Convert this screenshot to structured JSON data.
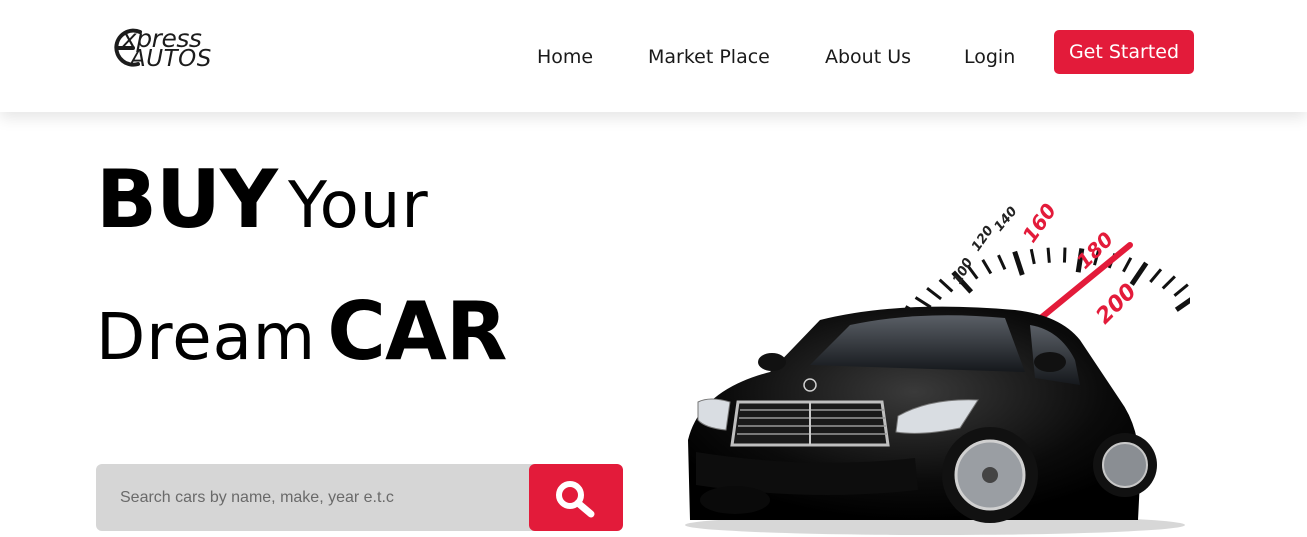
{
  "brand": {
    "logo_top": "xpress",
    "logo_bottom": "AUTOS"
  },
  "nav": {
    "items": [
      {
        "label": "Home"
      },
      {
        "label": "Market Place"
      },
      {
        "label": "About Us"
      },
      {
        "label": "Login"
      }
    ],
    "cta_label": "Get Started"
  },
  "hero": {
    "line1_bold": "BUY",
    "line1_light": "Your",
    "line2_light": "Dream",
    "line2_bold": "CAR"
  },
  "search": {
    "placeholder": "Search cars by name, make, year e.t.c",
    "button_icon": "search-icon"
  },
  "speedometer": {
    "ticks": [
      "100",
      "120",
      "140",
      "160",
      "180",
      "200"
    ]
  },
  "colors": {
    "accent": "#e31b3a",
    "text": "#1a1a1a",
    "input_bg": "#d6d6d6"
  }
}
